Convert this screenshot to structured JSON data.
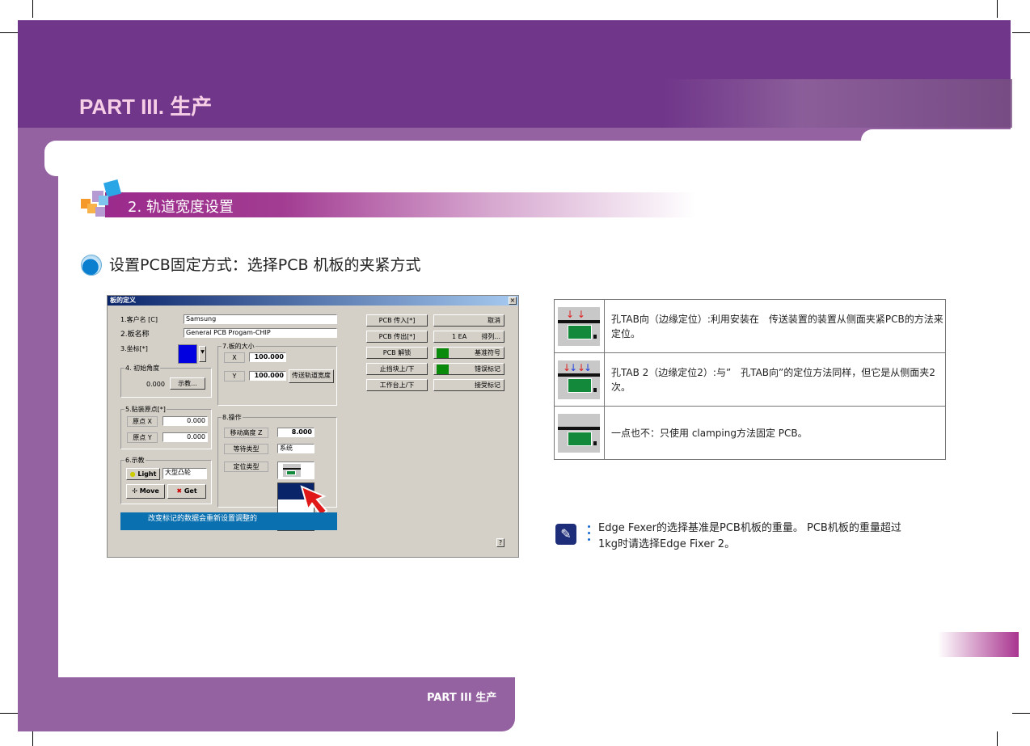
{
  "header": {
    "title": "PART III. 生产"
  },
  "section": {
    "title": "2. 轨道宽度设置"
  },
  "subtitle": "设置PCB固定方式：选择PCB 机板的夹紧方式",
  "footer": {
    "text": "PART III 生产"
  },
  "dialog": {
    "title": "板的定义",
    "close": "×",
    "customer_label": "1.客户名 [C]",
    "customer_value": "Samsung",
    "board_label": "2.板名称",
    "board_value": "General PCB Progam-CHIP",
    "coord_label": "3.坐标[*]",
    "angle_group": "4. 初始角度",
    "angle_value": "0.000",
    "teach_button": "示教...",
    "origin_group": "5.贴装原点[*]",
    "origin_x_label": "原点 X",
    "origin_x_value": "0.000",
    "origin_y_label": "原点 Y",
    "origin_y_value": "0.000",
    "teach_group": "6.示教",
    "light_button": "Light",
    "light_select": "大型凸轮",
    "move_button": "Move",
    "get_button": "Get",
    "size_group": "7.板的大小",
    "size_x_label": "X",
    "size_x_value": "100.000",
    "size_y_label": "Y",
    "size_y_value": "100.000",
    "conveyor_width_button": "传送轨道宽度",
    "op_group": "8.操作",
    "move_height_label": "移动高度 Z",
    "move_height_value": "8.000",
    "wait_type_label": "等待类型",
    "wait_type_value": "系统",
    "locate_type_label": "定位类型",
    "buttons_left": [
      "PCB 传入[*]",
      "PCB 传出[*]",
      "PCB 解锁",
      "止挡块上/下",
      "工作台上/下"
    ],
    "cancel": "取消",
    "array_count": "1 EA",
    "array_button": "排列...",
    "fiducial": "基准符号",
    "bad_mark": "错误标记",
    "accept_mark": "接受标记",
    "status": "改变标记的数据会重新设置调整的",
    "help": "?"
  },
  "table": [
    {
      "icon": "edge-tab-icon",
      "text": "孔TAB向（边缘定位）:利用安装在　传送装置的装置从侧面夹紧PCB的方法来定位。"
    },
    {
      "icon": "edge-tab2-icon",
      "text": "孔TAB 2（边缘定位2）:与”　孔TAB向”的定位方法同样，但它是从侧面夹2次。"
    },
    {
      "icon": "none-icon",
      "text": "一点也不：只使用 clamping方法固定 PCB。"
    }
  ],
  "note": {
    "line1": "Edge Fexer的选择基准是PCB机板的重量。 PCB机板的重量超过",
    "line2": "1kg时请选择Edge Fixer 2。"
  },
  "colors": {
    "header": "#70368a",
    "band": "#9562a1",
    "section": "#9b2a8c"
  }
}
